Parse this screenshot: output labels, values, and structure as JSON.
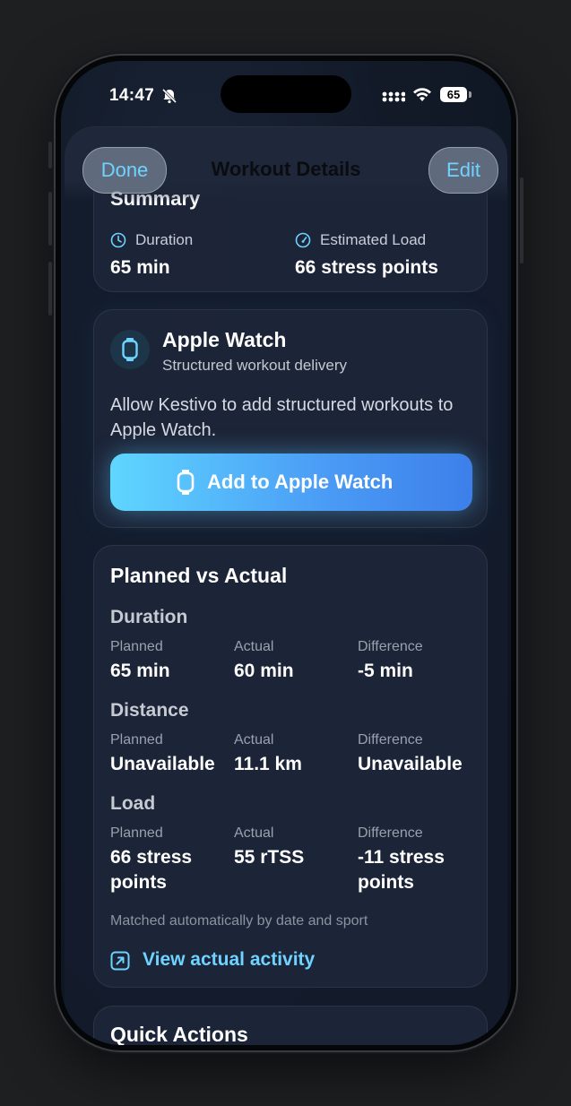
{
  "status_bar": {
    "time": "14:47",
    "battery": "65"
  },
  "nav": {
    "title": "Workout Details",
    "done_label": "Done",
    "edit_label": "Edit"
  },
  "summary": {
    "title": "Summary",
    "duration_label": "Duration",
    "duration_value": "65 min",
    "load_label": "Estimated Load",
    "load_value": "66 stress points"
  },
  "apple_watch": {
    "title": "Apple Watch",
    "subtitle": "Structured workout delivery",
    "description": "Allow Kestivo to add structured workouts to Apple Watch.",
    "button_label": "Add to Apple Watch"
  },
  "planned_vs_actual": {
    "title": "Planned vs Actual",
    "column_labels": {
      "planned": "Planned",
      "actual": "Actual",
      "difference": "Difference"
    },
    "sections": [
      {
        "title": "Duration",
        "planned": "65 min",
        "actual": "60 min",
        "difference": "-5 min"
      },
      {
        "title": "Distance",
        "planned": "Unavailable",
        "actual": "11.1 km",
        "difference": "Unavailable"
      },
      {
        "title": "Load",
        "planned": "66 stress points",
        "actual": "55 rTSS",
        "difference": "-11 stress points"
      }
    ],
    "note": "Matched automatically by date and sport",
    "link_label": "View actual activity"
  },
  "quick_actions": {
    "title": "Quick Actions"
  },
  "colors": {
    "accent": "#6fd3ff",
    "button_start": "#5fd6ff",
    "button_end": "#3d7fea"
  }
}
